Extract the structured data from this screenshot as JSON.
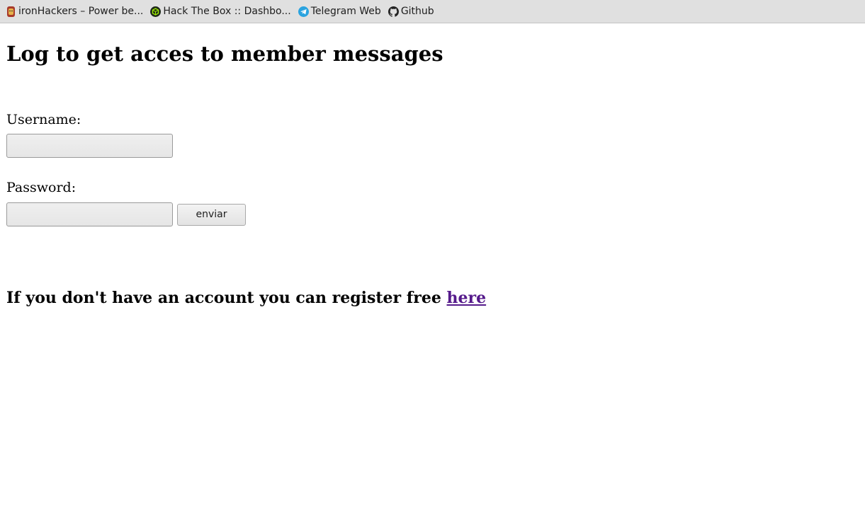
{
  "bookmarks": [
    {
      "label": "ironHackers – Power be...",
      "icon": "ironhackers-favicon"
    },
    {
      "label": "Hack The Box :: Dashbo...",
      "icon": "hackthebox-favicon"
    },
    {
      "label": "Telegram Web",
      "icon": "telegram-favicon"
    },
    {
      "label": "Github",
      "icon": "github-favicon"
    }
  ],
  "page": {
    "title": "Log to get acces to member messages",
    "username_label": "Username:",
    "username_value": "",
    "password_label": "Password:",
    "password_value": "",
    "submit_label": "enviar",
    "register_text": "If you don't have an account you can register free ",
    "register_link": "here"
  },
  "colors": {
    "link_visited": "#551a8b",
    "bookmarks_bar": "#e0e0e0"
  }
}
